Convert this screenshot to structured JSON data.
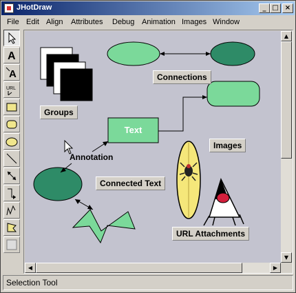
{
  "window": {
    "title": "JHotDraw",
    "controls": {
      "minimize": "_",
      "maximize": "□",
      "close": "×"
    }
  },
  "menu": [
    "File",
    "Edit",
    "Align",
    "Attributes",
    "Debug",
    "Animation",
    "Images",
    "Window"
  ],
  "tools": [
    {
      "name": "selection-tool",
      "icon": "arrow-icon",
      "active": true
    },
    {
      "name": "text-tool",
      "icon": "text-icon",
      "label": "A"
    },
    {
      "name": "connected-text-tool",
      "icon": "connected-text-icon",
      "label": "A"
    },
    {
      "name": "url-tool",
      "icon": "url-icon",
      "label": "URL"
    },
    {
      "name": "rectangle-tool",
      "icon": "rectangle-icon"
    },
    {
      "name": "round-rectangle-tool",
      "icon": "round-rectangle-icon"
    },
    {
      "name": "ellipse-tool",
      "icon": "ellipse-icon"
    },
    {
      "name": "line-tool",
      "icon": "line-icon"
    },
    {
      "name": "connection-tool",
      "icon": "connection-icon"
    },
    {
      "name": "elbow-connection-tool",
      "icon": "elbow-connection-icon"
    },
    {
      "name": "scribble-tool",
      "icon": "scribble-icon"
    },
    {
      "name": "polygon-tool",
      "icon": "polygon-icon"
    },
    {
      "name": "border-tool",
      "icon": "border-icon"
    }
  ],
  "canvas": {
    "labels": {
      "groups": "Groups",
      "connections": "Connections",
      "text_figure": "Text",
      "images": "Images",
      "annotation": "Annotation",
      "connected_text": "Connected Text",
      "url_attachments": "URL Attachments"
    },
    "colors": {
      "background": "#c3c3cf",
      "light_green": "#7bd99a",
      "dark_green": "#2e8b67",
      "label_bg": "#d4d0c8"
    }
  },
  "status": {
    "text": "Selection Tool"
  }
}
